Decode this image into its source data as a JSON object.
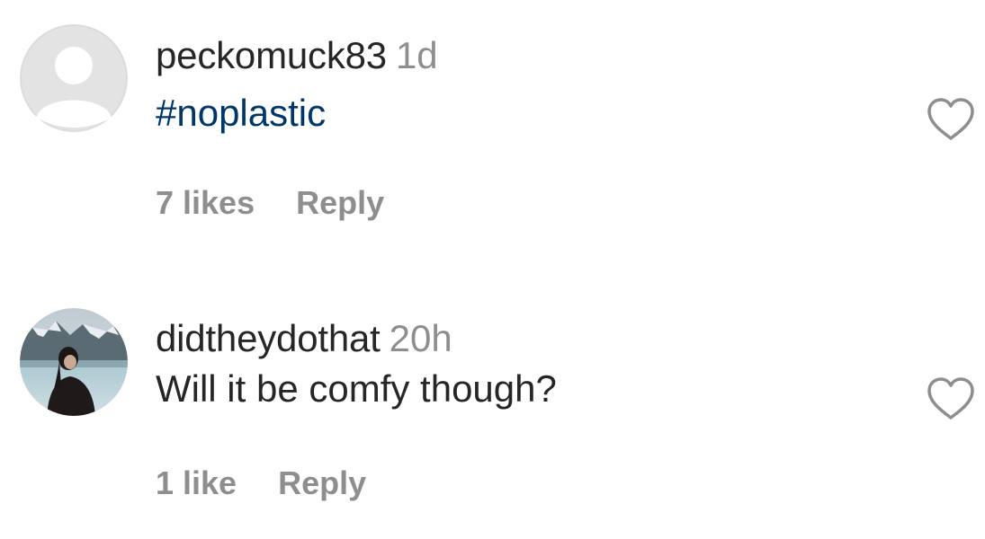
{
  "comments": [
    {
      "username": "peckomuck83",
      "timestamp": "1d",
      "text": "#noplastic",
      "likes": "7 likes",
      "reply_label": "Reply",
      "avatar_icon": "default-avatar-icon",
      "heart_icon": "heart-outline-icon"
    },
    {
      "username": "didtheydothat",
      "timestamp": "20h",
      "text": "Will it be comfy though?",
      "likes": "1 like",
      "reply_label": "Reply",
      "avatar_icon": "profile-photo",
      "heart_icon": "heart-outline-icon"
    }
  ],
  "colors": {
    "text_primary": "#262626",
    "text_secondary": "#8e8e8e",
    "hashtag": "#00376b",
    "avatar_placeholder": "#dbdbdb"
  }
}
